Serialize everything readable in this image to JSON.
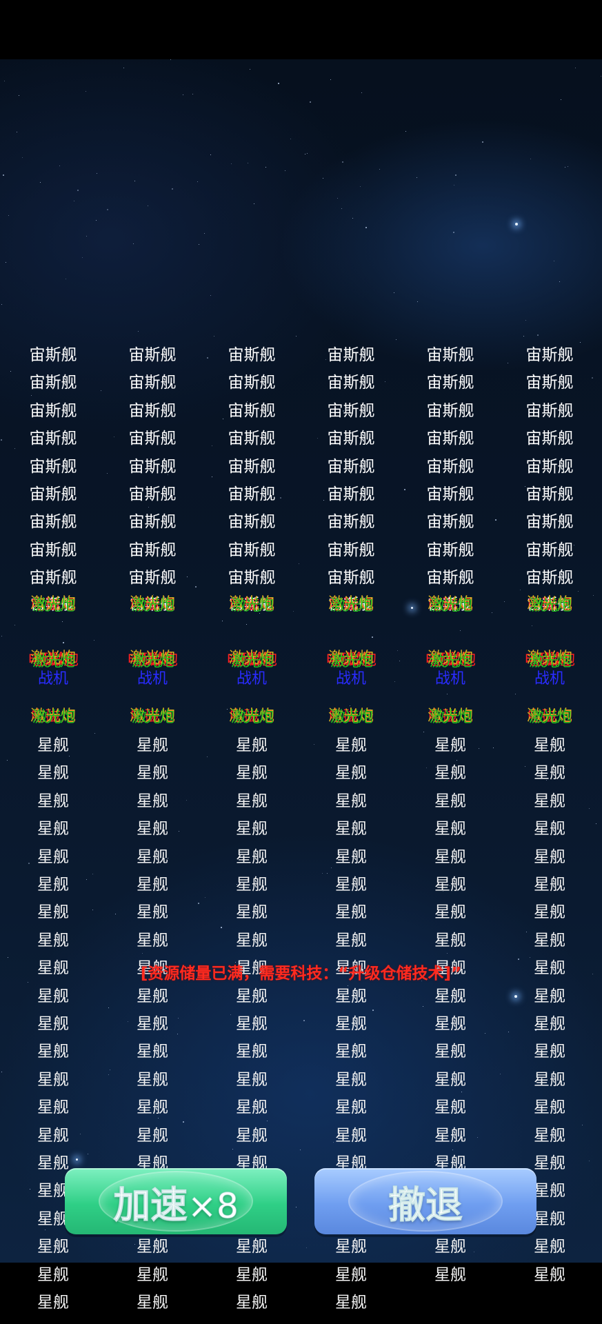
{
  "units": {
    "carrier": "宙斯舰",
    "ship": "星舰",
    "fighter": "战机",
    "electro_cannon": "电磁炮",
    "laser_cannon": "激光炮"
  },
  "warning_text": "[资源储量已满，需要科技：“升级仓储技术]”",
  "buttons": {
    "speed_label": "加速",
    "speed_multiplier": "×8",
    "retreat_label": "撤退"
  },
  "colors": {
    "warning": "#ff2a1f",
    "speed_button": "#2fcf86",
    "retreat_button": "#6f9ef0",
    "fighter_text": "#2a2cff"
  }
}
